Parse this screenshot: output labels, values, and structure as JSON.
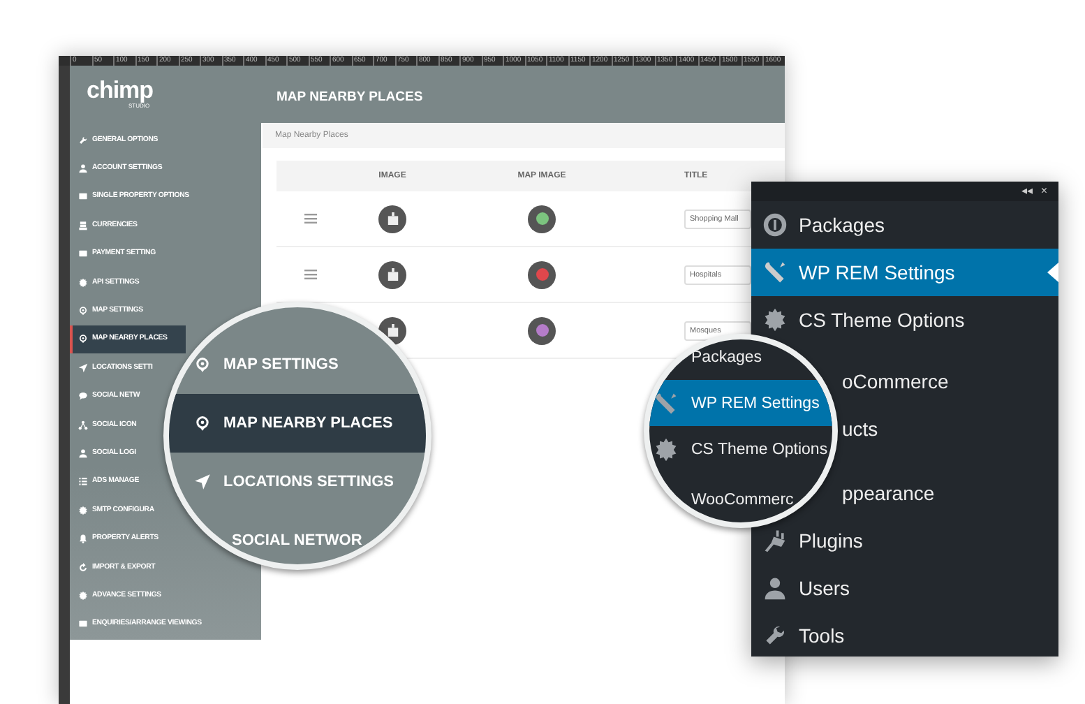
{
  "ruler": {
    "ticks": [
      "0",
      "50",
      "100",
      "150",
      "200",
      "250",
      "300",
      "350",
      "400",
      "450",
      "500",
      "550",
      "600",
      "650",
      "700",
      "750",
      "800",
      "850",
      "900",
      "950",
      "1000",
      "1050",
      "1100",
      "1150",
      "1200",
      "1250",
      "1300",
      "1350",
      "1400",
      "1450",
      "1500",
      "1550",
      "1600"
    ]
  },
  "sidebar": {
    "logo": "chimp",
    "logo_sub": "STUDIO",
    "items": [
      {
        "label": "GENERAL OPTIONS",
        "selected": false
      },
      {
        "label": "ACCOUNT SETTINGS",
        "selected": false
      },
      {
        "label": "SINGLE PROPERTY OPTIONS",
        "selected": false
      },
      {
        "label": "CURRENCIES",
        "selected": false
      },
      {
        "label": "PAYMENT SETTING",
        "selected": false
      },
      {
        "label": "API SETTINGS",
        "selected": false
      },
      {
        "label": "MAP SETTINGS",
        "selected": false
      },
      {
        "label": "MAP NEARBY PLACES",
        "selected": true
      },
      {
        "label": "LOCATIONS SETTI",
        "selected": false
      },
      {
        "label": "SOCIAL NETW",
        "selected": false
      },
      {
        "label": "SOCIAL ICON",
        "selected": false
      },
      {
        "label": "SOCIAL LOGI",
        "selected": false
      },
      {
        "label": "ADS MANAGE",
        "selected": false
      },
      {
        "label": "SMTP CONFIGURA",
        "selected": false
      },
      {
        "label": "PROPERTY ALERTS",
        "selected": false
      },
      {
        "label": "IMPORT & EXPORT",
        "selected": false
      },
      {
        "label": "ADVANCE SETTINGS",
        "selected": false
      },
      {
        "label": "ENQUIRIES/ARRANGE VIEWINGS",
        "selected": false
      }
    ]
  },
  "page": {
    "title": "MAP NEARBY PLACES",
    "breadcrumb": "Map Nearby Places",
    "table": {
      "columns": [
        "IMAGE",
        "MAP IMAGE",
        "TITLE"
      ],
      "rows": [
        {
          "color": "#7cc47f",
          "title": "Shopping Mall"
        },
        {
          "color": "#e0474c",
          "title": "Hospitals"
        },
        {
          "color": "#b57cc9",
          "title": "Mosques"
        }
      ]
    }
  },
  "left_lens": {
    "items": [
      {
        "label": "MAP SETTINGS",
        "selected": false
      },
      {
        "label": "MAP NEARBY PLACES",
        "selected": true
      },
      {
        "label": "LOCATIONS SETTINGS",
        "selected": false
      },
      {
        "label": "SOCIAL NETWOR",
        "selected": false
      }
    ]
  },
  "admin_menu": {
    "collapse": "◂◂",
    "close": "×",
    "items": [
      {
        "label": "Packages",
        "selected": false
      },
      {
        "label": "WP REM Settings",
        "selected": true
      },
      {
        "label": "CS Theme Options",
        "selected": false
      },
      {
        "label": "oCommerce",
        "selected": false
      },
      {
        "label": "ucts",
        "selected": false
      },
      {
        "label": "ppearance",
        "selected": false
      },
      {
        "label": "Plugins",
        "selected": false
      },
      {
        "label": "Users",
        "selected": false
      },
      {
        "label": "Tools",
        "selected": false
      }
    ]
  },
  "right_lens": {
    "items": [
      {
        "label": "Packages",
        "selected": false
      },
      {
        "label": "WP REM Settings",
        "selected": true
      },
      {
        "label": "CS Theme Options",
        "selected": false
      },
      {
        "label": "WooCommerc",
        "selected": false
      }
    ]
  }
}
